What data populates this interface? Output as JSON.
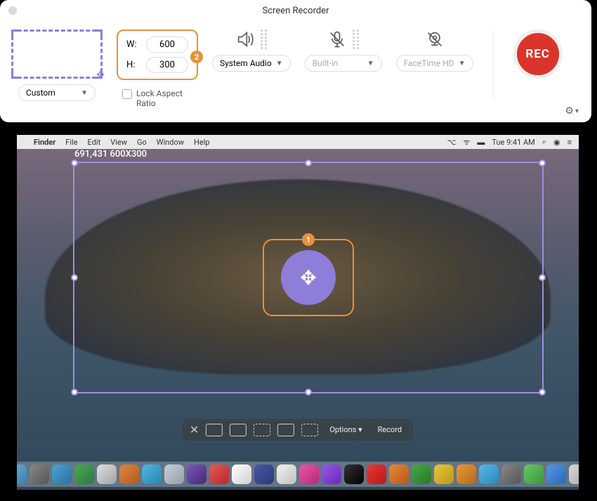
{
  "window": {
    "title": "Screen Recorder"
  },
  "region": {
    "mode_label": "Custom",
    "width_label": "W:",
    "height_label": "H:",
    "width_value": "600",
    "height_value": "300",
    "lock_label": "Lock Aspect Ratio"
  },
  "audio": {
    "source_label": "System Audio"
  },
  "mic": {
    "source_label": "Built-in"
  },
  "camera": {
    "source_label": "FaceTime HD"
  },
  "rec": {
    "label": "REC"
  },
  "annotations": {
    "badge1": "1",
    "badge2": "2"
  },
  "selection": {
    "info": "691,431 600X300"
  },
  "menubar": {
    "apple": "",
    "app": "Finder",
    "items": [
      "File",
      "Edit",
      "View",
      "Go",
      "Window",
      "Help"
    ],
    "time": "Tue 9:41 AM"
  },
  "screenshot_bar": {
    "options": "Options",
    "record": "Record"
  }
}
